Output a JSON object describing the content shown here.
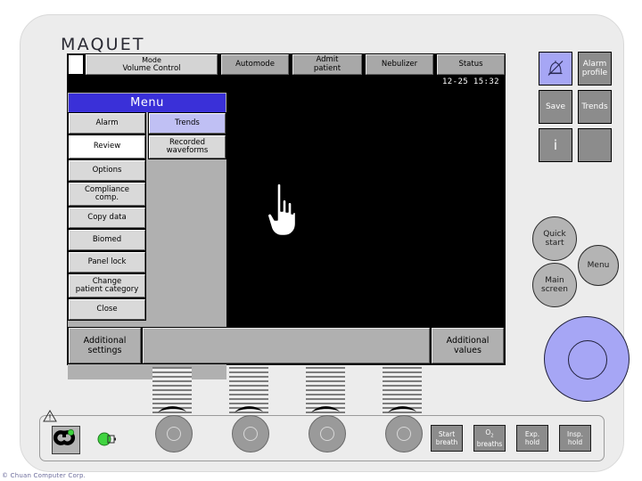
{
  "brand": {
    "logo": "MAQUET"
  },
  "screen": {
    "mode_box": {
      "label": "Mode",
      "value": "Volume Control"
    },
    "function_tabs": [
      {
        "label": "Automode"
      },
      {
        "label": "Admit",
        "label2": "patient"
      },
      {
        "label": "Nebulizer"
      },
      {
        "label": "Status"
      }
    ],
    "clock": "12-25 15:32",
    "menu": {
      "title": "Menu",
      "items": [
        {
          "label": "Alarm",
          "state": "normal"
        },
        {
          "label": "Trends",
          "state": "selected-blue"
        },
        {
          "label": "Review",
          "state": "selected-white"
        },
        {
          "label": "Recorded",
          "label2": "waveforms",
          "state": "normal"
        },
        {
          "label": "Options",
          "state": "normal"
        },
        {
          "label": "Compliance",
          "label2": "comp.",
          "state": "normal"
        },
        {
          "label": "Copy data",
          "state": "normal"
        },
        {
          "label": "Biomed",
          "state": "normal"
        },
        {
          "label": "Panel lock",
          "state": "normal"
        },
        {
          "label": "Change",
          "label2": "patient category",
          "state": "normal"
        },
        {
          "label": "Close",
          "state": "normal"
        }
      ]
    },
    "bottom_tabs": {
      "left": {
        "label": "Additional",
        "label2": "settings"
      },
      "right": {
        "label": "Additional",
        "label2": "values"
      }
    }
  },
  "hard_keys": {
    "grid": [
      {
        "icon": "alarm-silence-bell-icon",
        "label": "",
        "state": "highlighted"
      },
      {
        "label": "Alarm",
        "label2": "profile",
        "state": "normal"
      },
      {
        "label": "Save",
        "state": "normal"
      },
      {
        "label": "Trends",
        "state": "normal"
      },
      {
        "label": "i",
        "state": "normal"
      },
      {
        "label": "",
        "state": "normal"
      }
    ],
    "round": [
      {
        "label": "Quick",
        "label2": "start"
      },
      {
        "label": "Main",
        "label2": "screen"
      },
      {
        "label": "Menu",
        "label2": ""
      }
    ]
  },
  "bottom_panel": {
    "warning_icon": "warning-triangle-icon",
    "power_icon": "power-button-icon",
    "battery_icon": "battery-status-icon",
    "keys": [
      {
        "label": "Start",
        "label2": "breath"
      },
      {
        "label": "O2",
        "label2": "breaths",
        "subscript": true
      },
      {
        "label": "Exp.",
        "label2": "hold"
      },
      {
        "label": "Insp.",
        "label2": "hold"
      }
    ]
  },
  "knobs": {
    "count": 4
  },
  "watermark": "© Chuan Computer Corp.",
  "colors": {
    "menu_title": "#3a30d8",
    "selected_blue": "#c0c0f4",
    "screen_bg": "#000000",
    "chassis": "#ececec",
    "key_grey": "#8c8c8c",
    "dial_blue": "#a6a6f5",
    "led_green": "#3fd43f"
  }
}
